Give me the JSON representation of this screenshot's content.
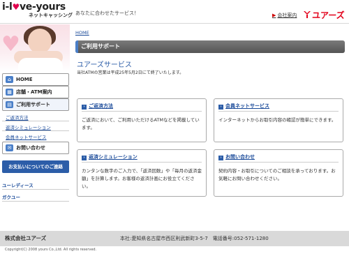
{
  "header": {
    "logo_main": "i-l",
    "logo_heart": "♥",
    "logo_rest": "ve-yours",
    "logo_sub": "ネットキャッシング",
    "tagline": "あなたに合わせたサービス！",
    "company_link": "会社案内",
    "brand": "ユアーズ",
    "brand_color": "#e2001a"
  },
  "sidebar": {
    "menu": [
      {
        "label": "HOME",
        "icon": "home-icon"
      },
      {
        "label": "店舗・ATM案内",
        "icon": "store-icon"
      },
      {
        "label": "ご利用サポート",
        "icon": "support-icon"
      }
    ],
    "submenu": [
      "ご返済方法",
      "返済シミュレーション",
      "会員ネットサービス"
    ],
    "inquiry": {
      "label": "お問い合わせ",
      "icon": "mail-icon"
    },
    "notice_button": "お支払いについてのご連絡",
    "links": [
      "ユーレディース",
      "ガクユー"
    ],
    "accent": "#2c5da8"
  },
  "main": {
    "breadcrumb": "HOME",
    "page_title": "ご利用サポート",
    "section_title": "ユアーズサービス",
    "section_note": "当社ATMの営業は平成25年5月2日にて終了いたします。",
    "cards": [
      {
        "title": "ご返済方法",
        "body": "ご返済において、ご利用いただけるATMなどを掲載しています。"
      },
      {
        "title": "会員ネットサービス",
        "body": "インターネットからお取引内容の確認が簡単にできます。"
      },
      {
        "title": "返済シミュレーション",
        "body": "カンタンな数字のご入力で、「返済回数」や「毎月の返済金額」を計算します。お客様の返済計画にお役立てください。"
      },
      {
        "title": "お問い合わせ",
        "body": "契約内容・お取引についてのご相談を承っております。お気軽にお問い合わせください。"
      }
    ]
  },
  "footer": {
    "company": "株式会社ユアーズ",
    "address": "本社:愛知県名古屋市西区則武新町3-5-7　電話番号:052-571-1280",
    "copyright": "Copyright(C) 2008 yours Co.,Ltd. All rights reserved."
  }
}
